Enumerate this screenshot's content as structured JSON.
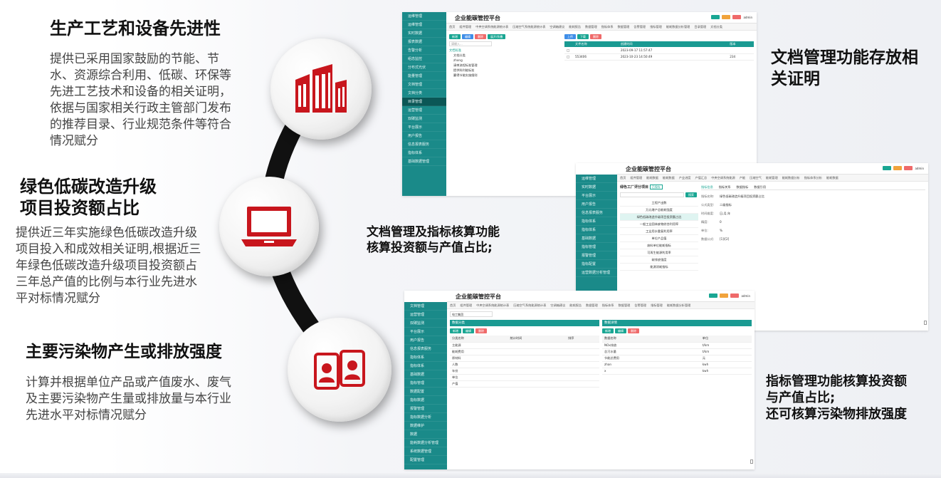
{
  "sections": [
    {
      "title": "生产工艺和设备先进性",
      "body": "提供已采用国家鼓励的节能、节水、资源综合利用、低碳、环保等先进工艺技术和设备的相关证明，依据与国家相关行政主管部门发布的推荐目录、行业规范条件等符合情况赋分",
      "icon": "buildings-icon"
    },
    {
      "title_line1": "绿色低碳改造升级",
      "title_line2": "项目投资额占比",
      "body": "提供近三年实施绿色低碳改造升级项目投入和成效相关证明,根据近三年绿色低碳改造升级项目投资额占三年总产值的比例与本行业先进水平对标情况赋分",
      "icon": "laptop-icon"
    },
    {
      "title": "主要污染物产生或排放强度",
      "body": "计算并根据单位产品或产值废水、废气及主要污染物产生量或排放量与本行业先进水平对标情况赋分",
      "icon": "id-cards-icon"
    }
  ],
  "captions": {
    "top_right_line1": "文档管理功能存放相",
    "top_right_line2": "关证明",
    "middle_line1": "文档管理及指标核算功能",
    "middle_line2": "核算投资额与产值占比;",
    "bottom_line1": "指标管理功能核算投资额",
    "bottom_line2": "与产值占比;",
    "bottom_line3": "还可核算污染物排放强度"
  },
  "app": {
    "title": "企业能碳管控平台",
    "user": "admin"
  },
  "screen1": {
    "side_items": [
      "运维管理",
      "运维管理",
      "实时数据",
      "报表数据",
      "告警分析",
      "组态监控",
      "分布式光伏",
      "能量管理",
      "文档管理",
      "文档分类",
      "目录管理",
      "运营管理",
      "双碳监测",
      "平台展示",
      "用户报告",
      "信息报表服务",
      "指标体系",
      "基础数据管理"
    ],
    "active_index": 10,
    "tabs": [
      "首页",
      "组件管理",
      "中央空调系统能源统计表",
      "压缩空气系统能源统计表",
      "空调箱建议",
      "能耗报告",
      "数据管理",
      "指标体系",
      "数据管理",
      "告警管理",
      "指标管理",
      "能耗数据分析管理",
      "目录管理",
      "文档分类"
    ],
    "tree_search_placeholder": "请输入...",
    "tree_root": "文档标准",
    "tree_items": [
      "文档分类",
      "zhong",
      "请审流程标准管理",
      "提供科利能标准",
      "赢得节能实施细则"
    ],
    "table_headers": [
      "文件名称",
      "创建时间",
      "版本"
    ],
    "rows": [
      {
        "name": "",
        "time": "2023-09-17 11:57:47",
        "ver": ""
      },
      {
        "name": "553406",
        "time": "2023-10-23 14:50:49",
        "ver": "234"
      }
    ],
    "buttons": [
      "新增",
      "编辑",
      "删除",
      "展开/折叠"
    ],
    "buttons2": [
      "上传",
      "下载",
      "删除"
    ]
  },
  "screen2": {
    "side_items": [
      "运维管理",
      "实时数据",
      "平台展示",
      "用户报告",
      "信息报表服务",
      "指标体系",
      "指标体系",
      "基础数据",
      "指标管理",
      "报警管理",
      "指标配置",
      "运营数据分析管理"
    ],
    "tabs": [
      "首页",
      "组件管理",
      "能耗数据",
      "能耗数据",
      "产业进度",
      "产值汇总",
      "中央空调系统能源",
      "产能",
      "压缩空气",
      "能耗管理",
      "能耗数据分析",
      "指标体系分析",
      "能耗数据"
    ],
    "panel_title": "绿色工厂评分项目",
    "panel_tag": "已保存",
    "search_label": "搜索",
    "list_items": [
      "工程产出数",
      "万元增产总能耗强度",
      "绿色低碳改造升级项目投资额占比",
      "一般工业固体废物综合利用率",
      "工业用水重复利用率",
      "单位产品值",
      "废料单位能耗指标",
      "可再生能源利用率",
      "碳排放强度",
      "能源消耗指标"
    ],
    "active_list": 2,
    "detail_tabs": [
      "指标信息",
      "指标关系",
      "数据指标",
      "数据引用"
    ],
    "fields": [
      {
        "k": "指标名称:",
        "v": "绿色低碳改造升级项目投资额占比"
      },
      {
        "k": "公式类型:",
        "v": "二级指标"
      },
      {
        "k": "时间维度:",
        "v": "日,月,年"
      },
      {
        "k": "精度:",
        "v": "0"
      },
      {
        "k": "单位:",
        "v": "%"
      },
      {
        "k": "数据公式:",
        "v": "[1]/[2]"
      }
    ]
  },
  "screen3": {
    "side_items": [
      "文档管理",
      "运营管理",
      "双碳监测",
      "平台展示",
      "用户报告",
      "信息报表服务",
      "指标体系",
      "指标体系",
      "基础数据",
      "指标管理",
      "数据配置",
      "指标数据",
      "报警管理",
      "指标数据分析",
      "数据维护",
      "数据",
      "能耗数据分析管理",
      "系统数据管理",
      "配置管理"
    ],
    "tabs": [
      "首页",
      "组件管理",
      "中央空调系统能源统计表",
      "压缩空气系统能源统计表",
      "空调箱建议",
      "能耗报告",
      "数据管理",
      "指标体系",
      "数据管理",
      "告警管理",
      "指标管理",
      "能耗数据分析管理"
    ],
    "company_select": "电工集团",
    "left_panel": "数据分类",
    "right_panel": "数据详情",
    "left_headers": [
      "分类名称",
      "统计时间",
      "排序"
    ],
    "left_rows": [
      "主能源",
      "能耗费用",
      "原材料",
      "人数",
      "年份",
      "单位",
      "产值"
    ],
    "right_headers": [
      "数据名称",
      "单位"
    ],
    "right_rows": [
      {
        "name": "NOx排放",
        "unit": "t/km"
      },
      {
        "name": "总污水量",
        "unit": "t/km"
      },
      {
        "name": "节能总费用",
        "unit": "元"
      },
      {
        "name": "zhan",
        "unit": "kwh"
      },
      {
        "name": "x",
        "unit": "kwh"
      }
    ],
    "buttons": [
      "新增",
      "编辑",
      "删除"
    ]
  }
}
